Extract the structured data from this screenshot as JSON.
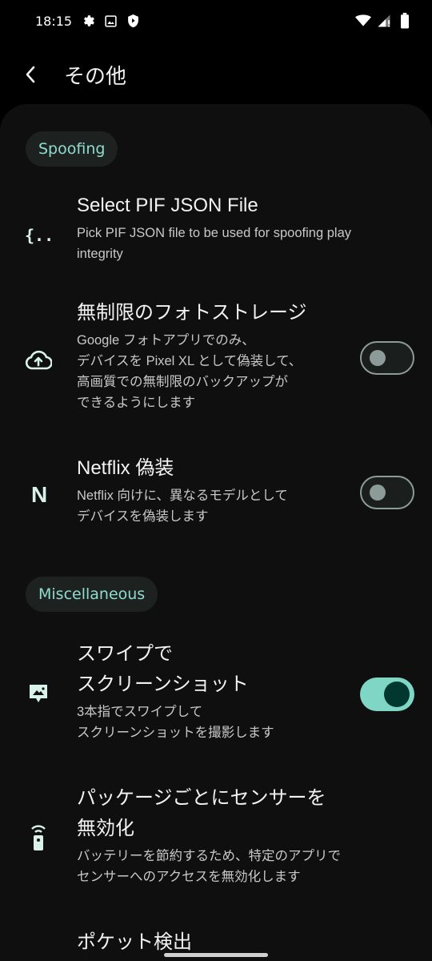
{
  "status": {
    "time": "18:15"
  },
  "appbar": {
    "title": "その他"
  },
  "sections": [
    {
      "label": "Spoofing"
    },
    {
      "label": "Miscellaneous"
    }
  ],
  "items": [
    {
      "title": "Select PIF JSON File",
      "summary": "Pick PIF JSON file to be used for spoofing play\nintegrity",
      "icon": "json-braces-icon"
    },
    {
      "title": "無制限のフォトストレージ",
      "summary": "Google フォトアプリでのみ、\nデバイスを Pixel XL として偽装して、\n高画質での無制限のバックアップが\nできるようにします",
      "icon": "cloud-upload-icon",
      "switch": false
    },
    {
      "title": "Netflix 偽装",
      "summary": "Netflix 向けに、異なるモデルとして\nデバイスを偽装します",
      "icon": "netflix-icon",
      "switch": false
    },
    {
      "title": "スワイプで\nスクリーンショット",
      "summary": "3本指でスワイプして\nスクリーンショットを撮影します",
      "icon": "screenshot-icon",
      "switch": true
    },
    {
      "title": "パッケージごとにセンサーを\n無効化",
      "summary": "バッテリーを節約するため、特定のアプリで\nセンサーへのアクセスを無効化します",
      "icon": "sensor-remote-icon"
    }
  ],
  "partial_item": {
    "title": "ポケット検出"
  }
}
